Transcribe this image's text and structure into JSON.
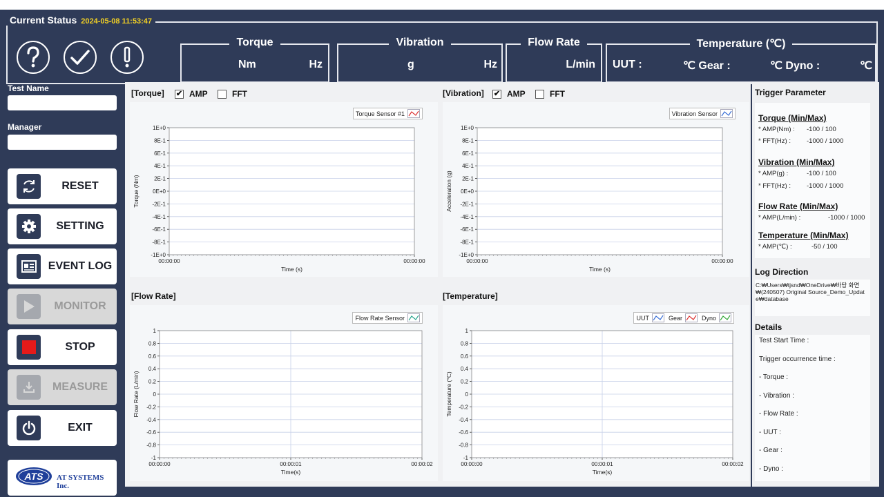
{
  "status": {
    "title": "Current Status",
    "timestamp": "2024-05-08 11:53:47",
    "icons": [
      "help-icon",
      "check-icon",
      "alert-icon"
    ],
    "torque": {
      "label": "Torque",
      "unit1": "Nm",
      "unit2": "Hz"
    },
    "vibration": {
      "label": "Vibration",
      "unit1": "g",
      "unit2": "Hz"
    },
    "flow": {
      "label": "Flow Rate",
      "unit1": "L/min"
    },
    "temperature": {
      "label": "Temperature (℃)",
      "uut": "UUT :",
      "gear": "℃ Gear :",
      "dyno": "℃ Dyno :",
      "end": "℃"
    }
  },
  "left": {
    "test_name_label": "Test Name",
    "test_name_value": "",
    "manager_label": "Manager",
    "manager_value": "",
    "buttons": [
      {
        "label": "RESET",
        "icon": "refresh-icon",
        "enabled": true
      },
      {
        "label": "SETTING",
        "icon": "gear-icon",
        "enabled": true
      },
      {
        "label": "EVENT LOG",
        "icon": "event-log-icon",
        "enabled": true
      },
      {
        "label": "MONITOR",
        "icon": "play-icon",
        "enabled": false
      },
      {
        "label": "STOP",
        "icon": "stop-icon",
        "enabled": true
      },
      {
        "label": "MEASURE",
        "icon": "download-icon",
        "enabled": false
      },
      {
        "label": "EXIT",
        "icon": "power-icon",
        "enabled": true
      }
    ],
    "logo_mark": "ATS",
    "logo_text": "AT SYSTEMS Inc."
  },
  "panels": {
    "torque": {
      "title": "[Torque]",
      "amp": "AMP",
      "fft": "FFT",
      "amp_checked": true,
      "fft_checked": false
    },
    "vibration": {
      "title": "[Vibration]",
      "amp": "AMP",
      "fft": "FFT",
      "amp_checked": true,
      "fft_checked": false
    },
    "flow": {
      "title": "[Flow Rate]"
    },
    "temperature": {
      "title": "[Temperature]"
    }
  },
  "chart_data": [
    {
      "type": "line",
      "ylabel": "Torque (Nm)",
      "xlabel": "Time (s)",
      "yticks": [
        "1E+0",
        "8E-1",
        "6E-1",
        "4E-1",
        "2E-1",
        "0E+0",
        "-2E-1",
        "-4E-1",
        "-6E-1",
        "-8E-1",
        "-1E+0"
      ],
      "xticks": [
        "00:00:00",
        "00:00:00"
      ],
      "ylim": [
        -1,
        1
      ],
      "grid": true,
      "legend": "top-right",
      "series": [
        {
          "name": "Torque Sensor #1",
          "values": []
        }
      ],
      "legend_color": "#d33"
    },
    {
      "type": "line",
      "ylabel": "Acceleration (g)",
      "xlabel": "Time (s)",
      "yticks": [
        "1E+0",
        "8E-1",
        "6E-1",
        "4E-1",
        "2E-1",
        "0E+0",
        "-2E-1",
        "-4E-1",
        "-6E-1",
        "-8E-1",
        "-1E+0"
      ],
      "xticks": [
        "00:00:00",
        "00:00:00"
      ],
      "ylim": [
        -1,
        1
      ],
      "grid": true,
      "legend": "top-right",
      "series": [
        {
          "name": "Vibration Sensor",
          "values": []
        }
      ],
      "legend_color": "#3a6fd6"
    },
    {
      "type": "line",
      "ylabel": "Flow Rate (L/min)",
      "xlabel": "Time(s)",
      "yticks": [
        "1",
        "0.8",
        "0.6",
        "0.4",
        "0.2",
        "0",
        "-0.2",
        "-0.4",
        "-0.6",
        "-0.8",
        "-1"
      ],
      "xticks": [
        "00:00:00",
        "00:00:01",
        "00:00:02"
      ],
      "ylim": [
        -1,
        1
      ],
      "grid": true,
      "legend": "top-right",
      "series": [
        {
          "name": "Flow Rate Sensor",
          "values": []
        }
      ],
      "legend_color": "#2aa58f"
    },
    {
      "type": "line",
      "ylabel": "Temperature (℃)",
      "xlabel": "Time(s)",
      "yticks": [
        "1",
        "0.8",
        "0.6",
        "0.4",
        "0.2",
        "0",
        "-0.2",
        "-0.4",
        "-0.6",
        "-0.8",
        "-1"
      ],
      "xticks": [
        "00:00:00",
        "00:00:01",
        "00:00:02"
      ],
      "ylim": [
        -1,
        1
      ],
      "grid": true,
      "legend": "top-right",
      "series": [
        {
          "name": "UUT",
          "values": [],
          "color": "#3a6fd6"
        },
        {
          "name": "Gear",
          "values": [],
          "color": "#d33"
        },
        {
          "name": "Dyno",
          "values": [],
          "color": "#35a83a"
        }
      ]
    }
  ],
  "right": {
    "trigger_title": "Trigger Parameter",
    "torque": {
      "title": "Torque (Min/Max)",
      "rows": [
        [
          "* AMP(Nm) :",
          "-100 / 100"
        ],
        [
          "* FFT(Hz)    :",
          "-1000 / 1000"
        ]
      ]
    },
    "vibration": {
      "title": "Vibration (Min/Max)",
      "rows": [
        [
          "* AMP(g)    :",
          "-100 / 100"
        ],
        [
          "* FFT(Hz)    :",
          "-1000 / 1000"
        ]
      ]
    },
    "flow": {
      "title": "Flow Rate (Min/Max)",
      "rows": [
        [
          "* AMP(L/min) :",
          "-1000 / 1000"
        ]
      ]
    },
    "temp": {
      "title": "Temperature (Min/Max)",
      "rows": [
        [
          "* AMP(℃)    :",
          "-50 / 100"
        ]
      ]
    },
    "log_title": "Log Direction",
    "log_path": "C:₩Users₩tjsnd₩OneDrive₩바탕 화면₩(240507) Original Source_Demo_Update₩database",
    "details_title": "Details",
    "details": [
      "Test Start Time :",
      "Trigger occurrence time :",
      "- Torque :",
      "- Vibration :",
      "- Flow Rate :",
      "- UUT :",
      "- Gear :",
      "- Dyno :"
    ]
  }
}
